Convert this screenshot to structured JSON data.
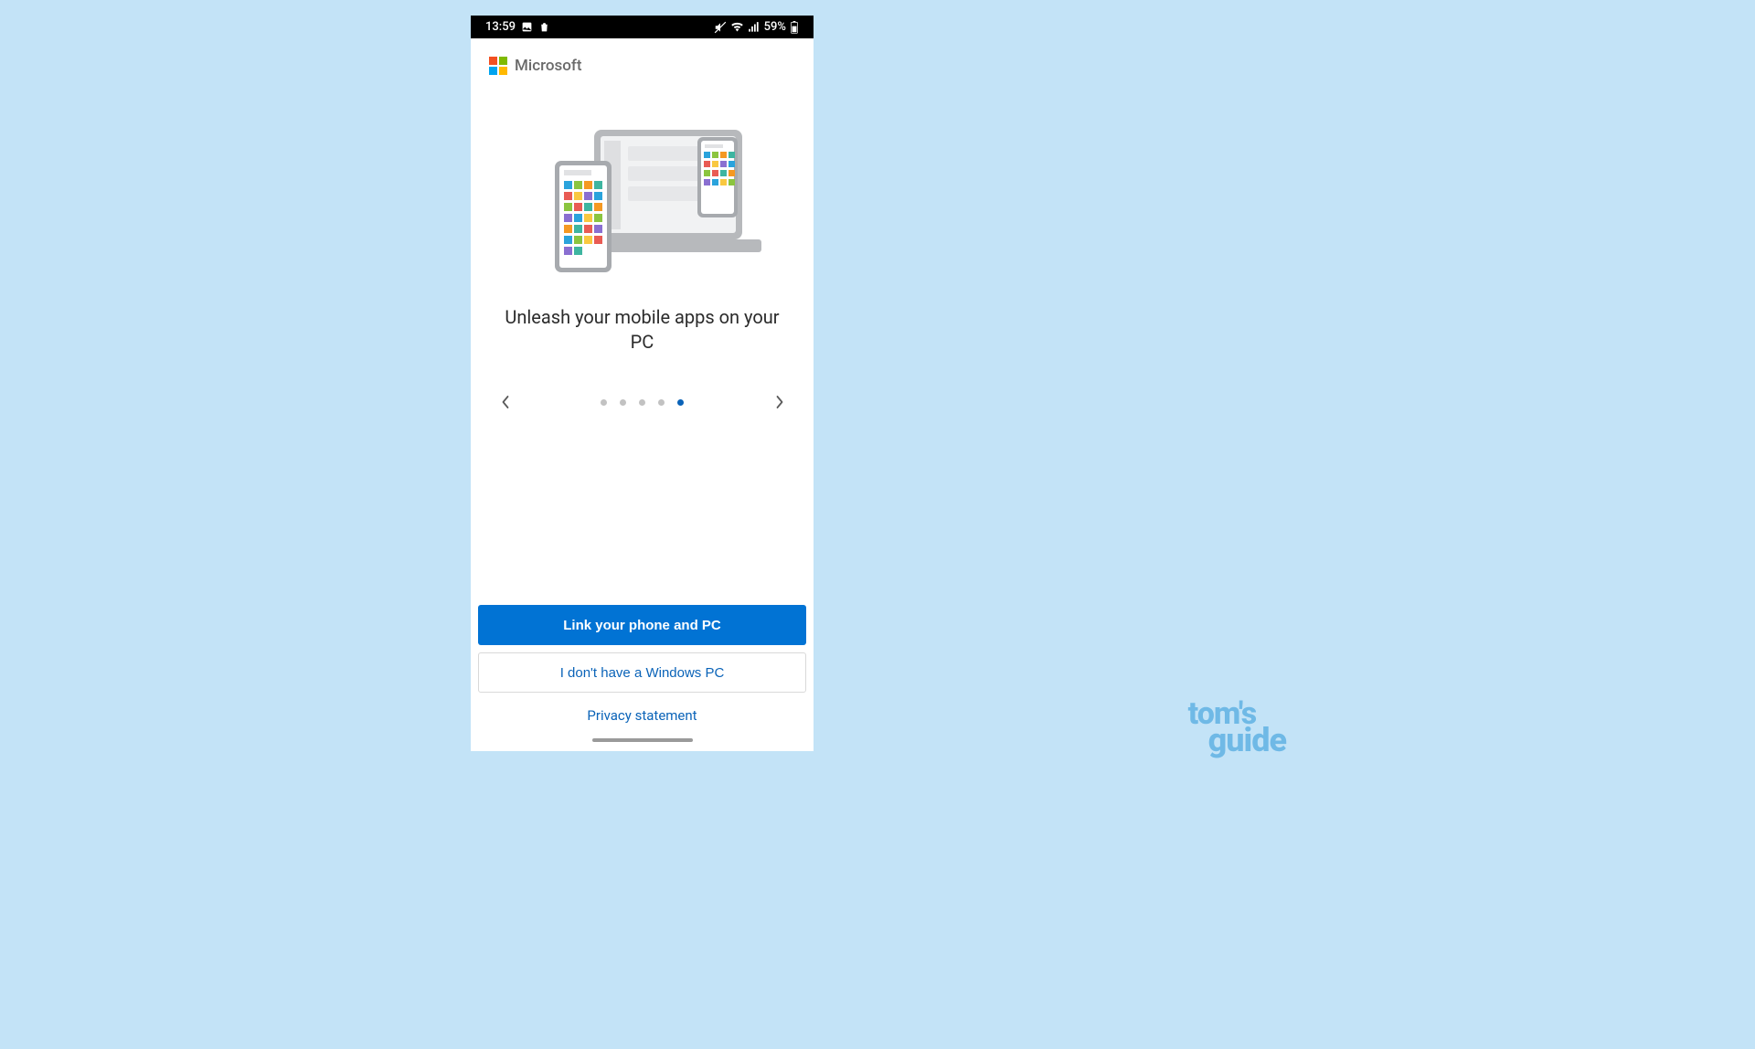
{
  "status_bar": {
    "time": "13:59",
    "battery": "59%"
  },
  "brand": {
    "name": "Microsoft"
  },
  "hero": {
    "title": "Unleash your mobile apps on your PC"
  },
  "carousel": {
    "total": 5,
    "active_index": 4
  },
  "buttons": {
    "primary": "Link your phone and PC",
    "secondary": "I don't have a Windows PC",
    "privacy": "Privacy statement"
  },
  "watermark": {
    "line1": "tom's",
    "line2": "guide"
  }
}
